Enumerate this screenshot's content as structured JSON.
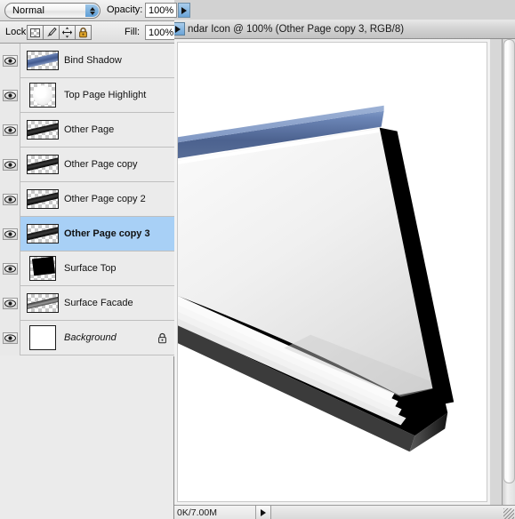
{
  "app": "Adobe Photoshop",
  "layers_panel": {
    "blend_mode": {
      "value": "Normal",
      "name": "blend-mode-select"
    },
    "opacity": {
      "label": "Opacity:",
      "value": "100%"
    },
    "fill": {
      "label": "Fill:",
      "value": "100%"
    },
    "lock": {
      "label": "Lock:",
      "buttons": [
        {
          "name": "lock-transparent-pixels",
          "icon": "checkerboard-icon"
        },
        {
          "name": "lock-image-pixels",
          "icon": "brush-icon"
        },
        {
          "name": "lock-position",
          "icon": "move-icon"
        },
        {
          "name": "lock-all",
          "icon": "padlock-icon"
        }
      ]
    },
    "layers": [
      {
        "name": "Bind Shadow",
        "visible": true,
        "selected": false,
        "locked": false,
        "thumb": "blue-streak",
        "italic": false
      },
      {
        "name": "Top Page Highlight",
        "visible": true,
        "selected": false,
        "locked": false,
        "thumb": "oval-blob",
        "italic": false
      },
      {
        "name": "Other Page",
        "visible": true,
        "selected": false,
        "locked": false,
        "thumb": "dark-streak",
        "italic": false
      },
      {
        "name": "Other Page copy",
        "visible": true,
        "selected": false,
        "locked": false,
        "thumb": "dark-streak",
        "italic": false
      },
      {
        "name": "Other Page copy 2",
        "visible": true,
        "selected": false,
        "locked": false,
        "thumb": "dark-streak",
        "italic": false
      },
      {
        "name": "Other Page copy 3",
        "visible": true,
        "selected": true,
        "locked": false,
        "thumb": "dark-streak",
        "italic": false
      },
      {
        "name": "Surface Top",
        "visible": true,
        "selected": false,
        "locked": false,
        "thumb": "black-page",
        "italic": false
      },
      {
        "name": "Surface Facade",
        "visible": true,
        "selected": false,
        "locked": false,
        "thumb": "gray-streak",
        "italic": false
      },
      {
        "name": "Background",
        "visible": true,
        "selected": false,
        "locked": true,
        "thumb": "white-square",
        "italic": true
      }
    ]
  },
  "document_window": {
    "title": "ndar Icon @ 100% (Other Page copy 3, RGB/8)",
    "zoom": "100%",
    "active_layer": "Other Page copy 3",
    "color_mode": "RGB/8",
    "status": "0K/7.00M"
  },
  "colors": {
    "selection_blue": "#a8d0f6",
    "stepper_blue": "#6ba4d8",
    "panel_gray": "#ebebeb",
    "artwork_binding_blue": "#4e6494",
    "artwork_cover_black": "#000000"
  }
}
